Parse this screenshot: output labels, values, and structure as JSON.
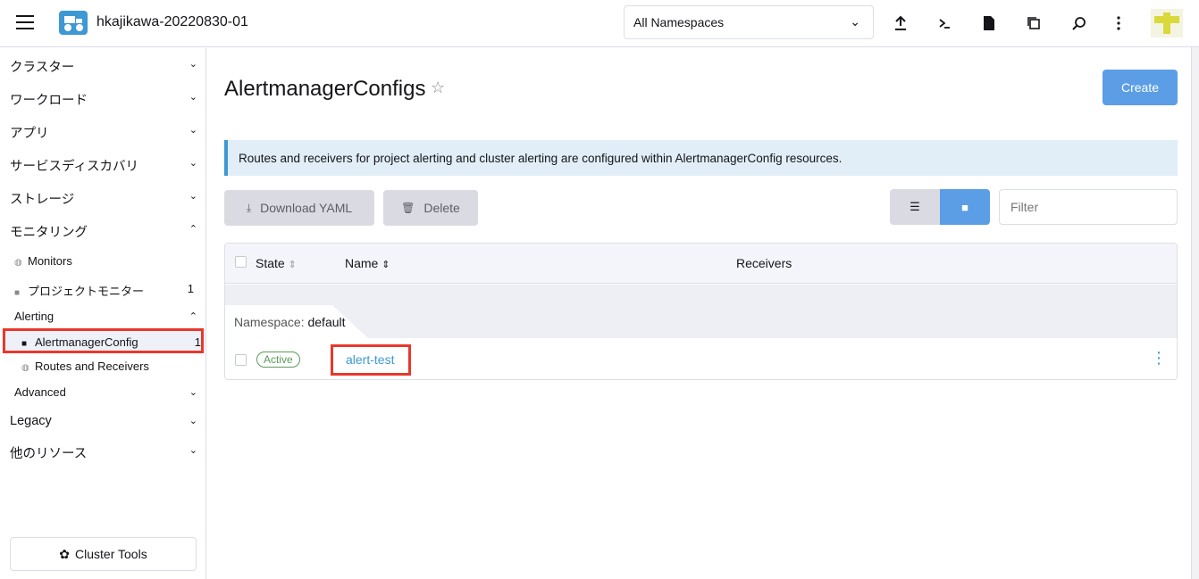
{
  "header": {
    "cluster_name": "hkajikawa-20220830-01",
    "namespace_select": "All Namespaces",
    "icons": [
      "upload-icon",
      "terminal-icon",
      "file-icon",
      "copy-config-icon",
      "search-icon",
      "more-icon"
    ]
  },
  "sidebar": {
    "groups": {
      "cluster": "クラスター",
      "workload": "ワークロード",
      "apps": "アプリ",
      "service_discovery": "サービスディスカバリ",
      "storage": "ストレージ",
      "monitoring": "モニタリング",
      "legacy": "Legacy",
      "other_resources": "他のリソース"
    },
    "monitoring_items": {
      "monitors": "Monitors",
      "project_monitors": "プロジェクトモニター",
      "project_monitors_count": "1",
      "alerting": "Alerting",
      "alertmanager_config": "AlertmanagerConfig",
      "alertmanager_config_count": "1",
      "routes_receivers": "Routes and Receivers",
      "advanced": "Advanced"
    },
    "cluster_tools": "Cluster Tools"
  },
  "main": {
    "title": "AlertmanagerConfigs",
    "create_label": "Create",
    "banner": "Routes and receivers for project alerting and cluster alerting are configured within AlertmanagerConfig resources.",
    "download_yaml": "Download YAML",
    "delete": "Delete",
    "filter_placeholder": "Filter",
    "table": {
      "columns": {
        "state": "State",
        "name": "Name",
        "receivers": "Receivers"
      },
      "group_label": "Namespace:",
      "group_value": "default",
      "rows": [
        {
          "state": "Active",
          "name": "alert-test",
          "receivers": ""
        }
      ]
    }
  },
  "colors": {
    "accent": "#3d98d3",
    "primary_button": "#5b9ee6",
    "highlight": "#e8382b",
    "active_state": "#5d995d"
  }
}
